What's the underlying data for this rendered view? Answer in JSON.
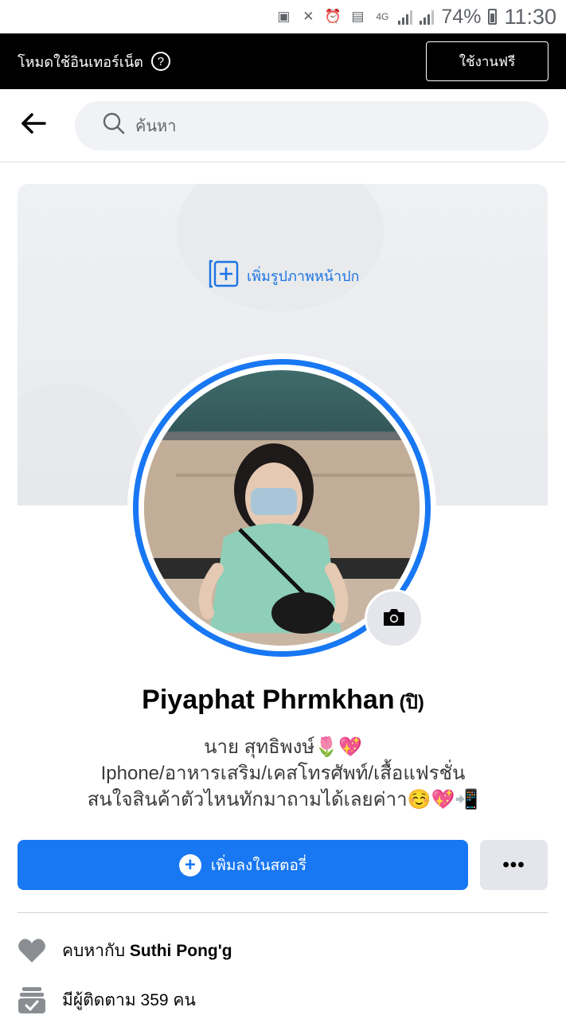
{
  "status_bar": {
    "battery": "74%",
    "time": "11:30",
    "network": "4G"
  },
  "free_mode": {
    "label": "โหมดใช้อินเทอร์เน็ต",
    "help": "?",
    "button": "ใช้งานฟรี"
  },
  "search": {
    "placeholder": "ค้นหา"
  },
  "cover": {
    "add_label": "เพิ่มรูปภาพหน้าปก"
  },
  "profile": {
    "name": "Piyaphat Phrmkhan",
    "alt_name": "(ปิ)",
    "bio_lines": [
      "นาย  สุทธิพงษ์🌷💖",
      "Iphone/อาหารเสริม/เคสโทรศัพท์/เสื้อแฟรชั่น",
      "สนใจสินค้าตัวไหนทักมาถามได้เลยค่าา☺️💖📲"
    ]
  },
  "actions": {
    "add_story": "เพิ่มลงในสตอรี่",
    "more": "•••"
  },
  "details": {
    "relationship_prefix": "คบหากับ",
    "relationship_name": "Suthi Pong'g",
    "followers": "มีผู้ติดตาม 359 คน"
  },
  "colors": {
    "accent": "#1877f2",
    "cover_link": "#1b74e4",
    "bar": "#000000"
  },
  "icons": {
    "back": "arrow-left-icon",
    "search": "search-icon",
    "add_cover": "add-photo-icon",
    "camera": "camera-icon",
    "story_plus": "plus-circle-icon",
    "relationship": "heart-icon",
    "followers": "followers-icon"
  }
}
